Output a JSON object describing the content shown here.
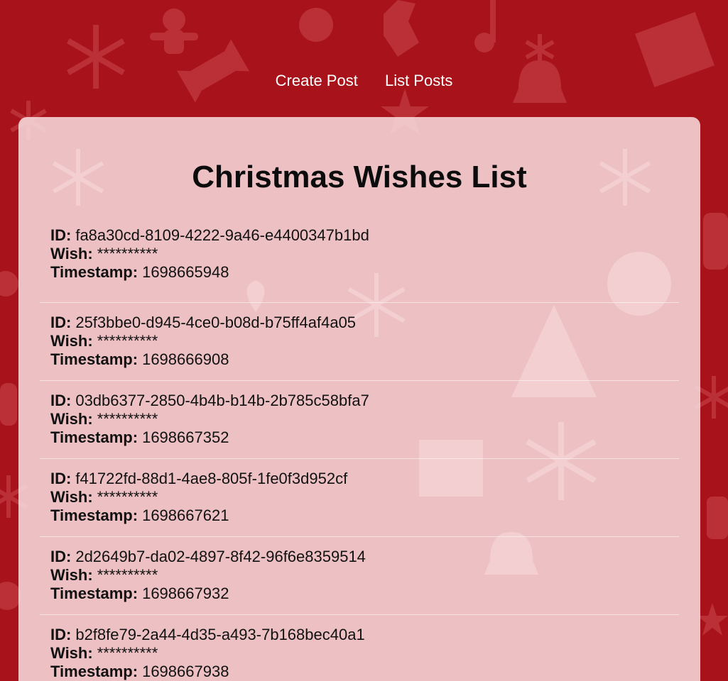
{
  "nav": {
    "create_post": "Create Post",
    "list_posts": "List Posts"
  },
  "page": {
    "title": "Christmas Wishes List"
  },
  "labels": {
    "id": "ID:",
    "wish": "Wish:",
    "timestamp": "Timestamp:"
  },
  "wishes": [
    {
      "id": "fa8a30cd-8109-4222-9a46-e4400347b1bd",
      "wish": "**********",
      "timestamp": "1698665948"
    },
    {
      "id": "25f3bbe0-d945-4ce0-b08d-b75ff4af4a05",
      "wish": "**********",
      "timestamp": "1698666908"
    },
    {
      "id": "03db6377-2850-4b4b-b14b-2b785c58bfa7",
      "wish": "**********",
      "timestamp": "1698667352"
    },
    {
      "id": "f41722fd-88d1-4ae8-805f-1fe0f3d952cf",
      "wish": "**********",
      "timestamp": "1698667621"
    },
    {
      "id": "2d2649b7-da02-4897-8f42-96f6e8359514",
      "wish": "**********",
      "timestamp": "1698667932"
    },
    {
      "id": "b2f8fe79-2a44-4d35-a493-7b168bec40a1",
      "wish": "**********",
      "timestamp": "1698667938"
    }
  ],
  "colors": {
    "background": "#a8121b",
    "pattern": "#c0353b",
    "card": "#f8dee0",
    "nav_text": "#ffffff"
  }
}
